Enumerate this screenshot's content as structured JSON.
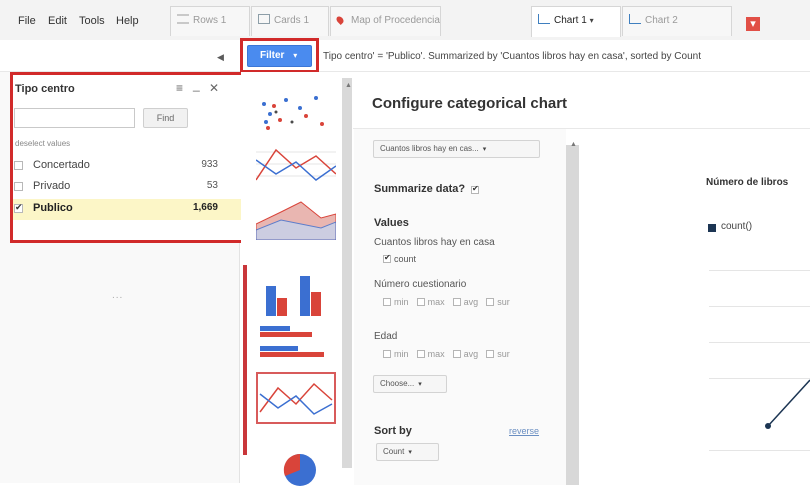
{
  "menu": {
    "file": "File",
    "edit": "Edit",
    "tools": "Tools",
    "help": "Help"
  },
  "tabs": [
    {
      "label": "Rows 1",
      "icon": "rows-icon"
    },
    {
      "label": "Cards 1",
      "icon": "cards-icon"
    },
    {
      "label": "Map of Procedencia",
      "icon": "map-pin-icon"
    },
    {
      "label": "Chart 1",
      "icon": "chart-icon",
      "active": true
    },
    {
      "label": "Chart 2",
      "icon": "chart-icon"
    }
  ],
  "add_tab_symbol": "▾",
  "filter_button": {
    "label": "Filter",
    "caret": "▾"
  },
  "filter_description": "Tipo centro' = 'Publico'. Summarized by 'Cuantos libros hay en casa', sorted by Count",
  "filter_panel": {
    "title": "Tipo centro",
    "menu_icon": "≡",
    "minimize_icon": "_",
    "close_icon": "✕",
    "find_label": "Find",
    "deselect_label": "deselect values",
    "rows": [
      {
        "label": "Concertado",
        "count": "933",
        "checked": false
      },
      {
        "label": "Privado",
        "count": "53",
        "checked": false
      },
      {
        "label": "Publico",
        "count": "1,669",
        "checked": true
      }
    ],
    "dots": "..."
  },
  "config": {
    "heading": "Configure categorical chart",
    "column_dropdown": "Cuantos libros hay en cas...",
    "summarize_label": "Summarize data?",
    "values_label": "Values",
    "field1": "Cuantos libros hay en casa",
    "field1_opt": "count",
    "field2": "Número cuestionario",
    "field3": "Edad",
    "agg_options": [
      "min",
      "max",
      "avg",
      "sur"
    ],
    "choose_label": "Choose...",
    "sort_by_label": "Sort by",
    "reverse_label": "reverse",
    "sort_value": "Count"
  },
  "preview": {
    "title": "Número de libros",
    "legend": "count()",
    "legend_color": "#1c3553"
  },
  "colors": {
    "accent_blue": "#4a8bef",
    "highlight_red": "#d12a2a",
    "series_red": "#d9443a",
    "series_blue": "#3b6fd1"
  }
}
